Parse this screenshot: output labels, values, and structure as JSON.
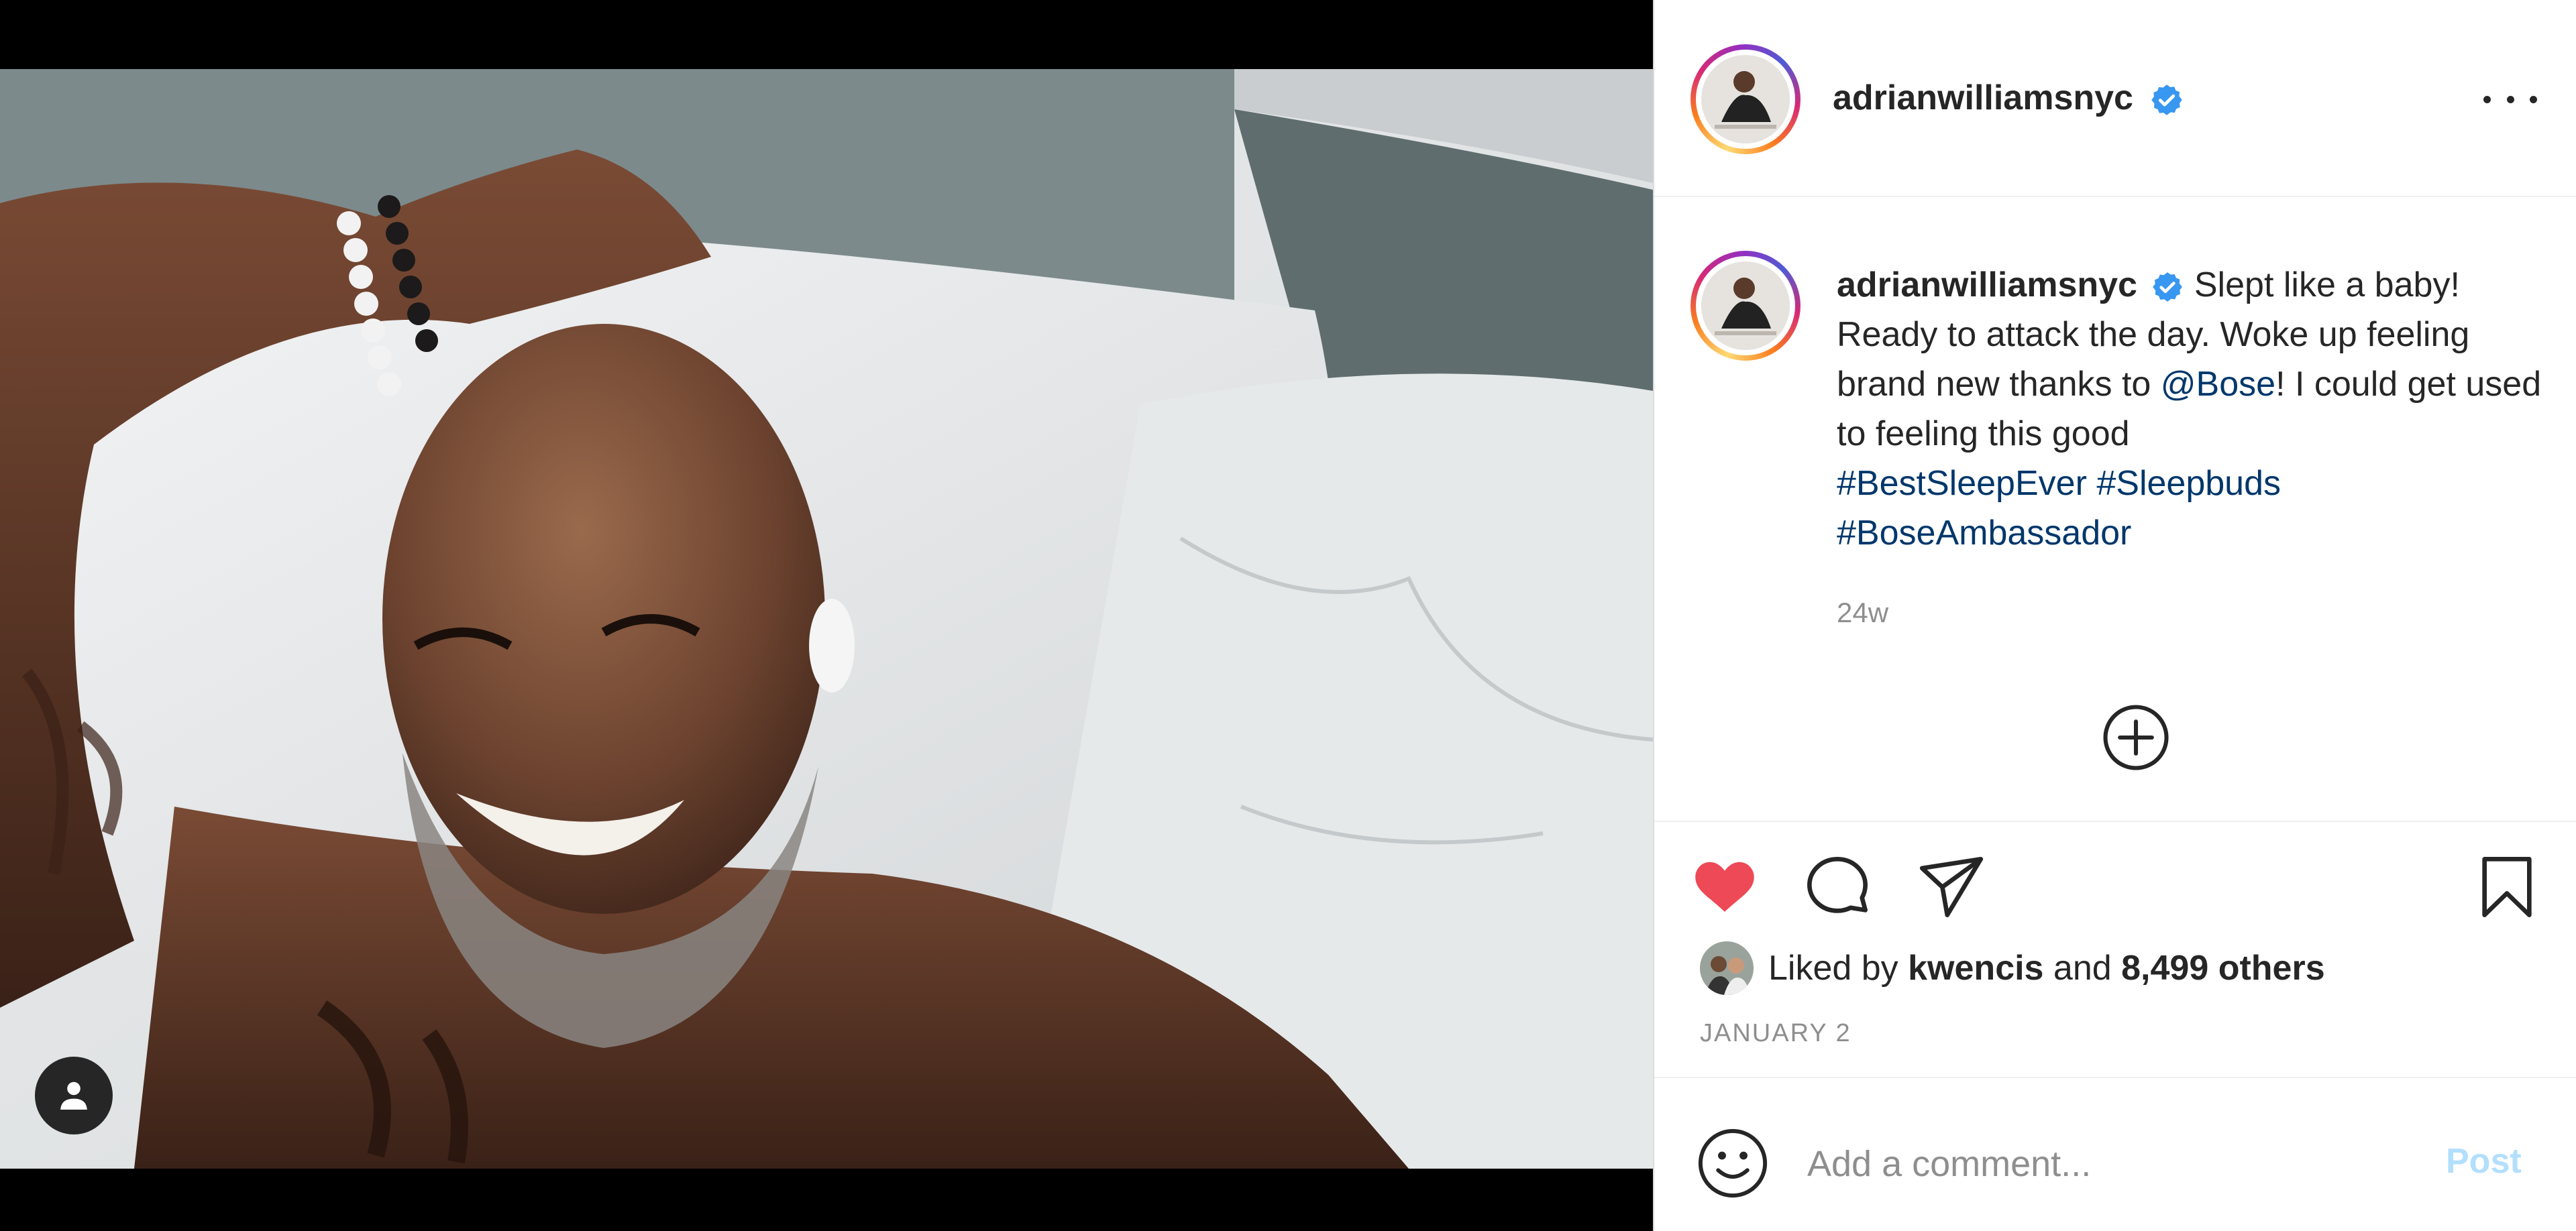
{
  "post": {
    "username": "adrianwilliamsnyc",
    "verified": true,
    "caption": {
      "text_1": " Slept like a baby! Ready to attack the day. Woke up feeling brand new thanks to ",
      "mention": "@Bose",
      "text_2": "! I could get used to feeling this good ",
      "hashtags": [
        "#BestSleepEver",
        "#Sleepbuds",
        "#BoseAmbassador"
      ]
    },
    "relative_time": "24w",
    "likes": {
      "prefix": "Liked by ",
      "liker": "kwencis",
      "middle": " and ",
      "count": "8,499 others"
    },
    "date": "JANUARY 2"
  },
  "comment_box": {
    "placeholder": "Add a comment...",
    "post_label": "Post"
  },
  "icons": {
    "more": "more-options-icon",
    "verified": "verified-badge-icon",
    "like": "heart-filled-icon",
    "comment": "comment-bubble-icon",
    "share": "paper-plane-icon",
    "save": "bookmark-icon",
    "load_more": "plus-circle-icon",
    "emoji": "smiley-icon",
    "user_tag": "user-tag-icon"
  },
  "colors": {
    "like": "#ed4956",
    "link": "#00376b",
    "verified": "#3897f0",
    "post_disabled": "#b2dffc",
    "muted": "#8e8e8e"
  }
}
